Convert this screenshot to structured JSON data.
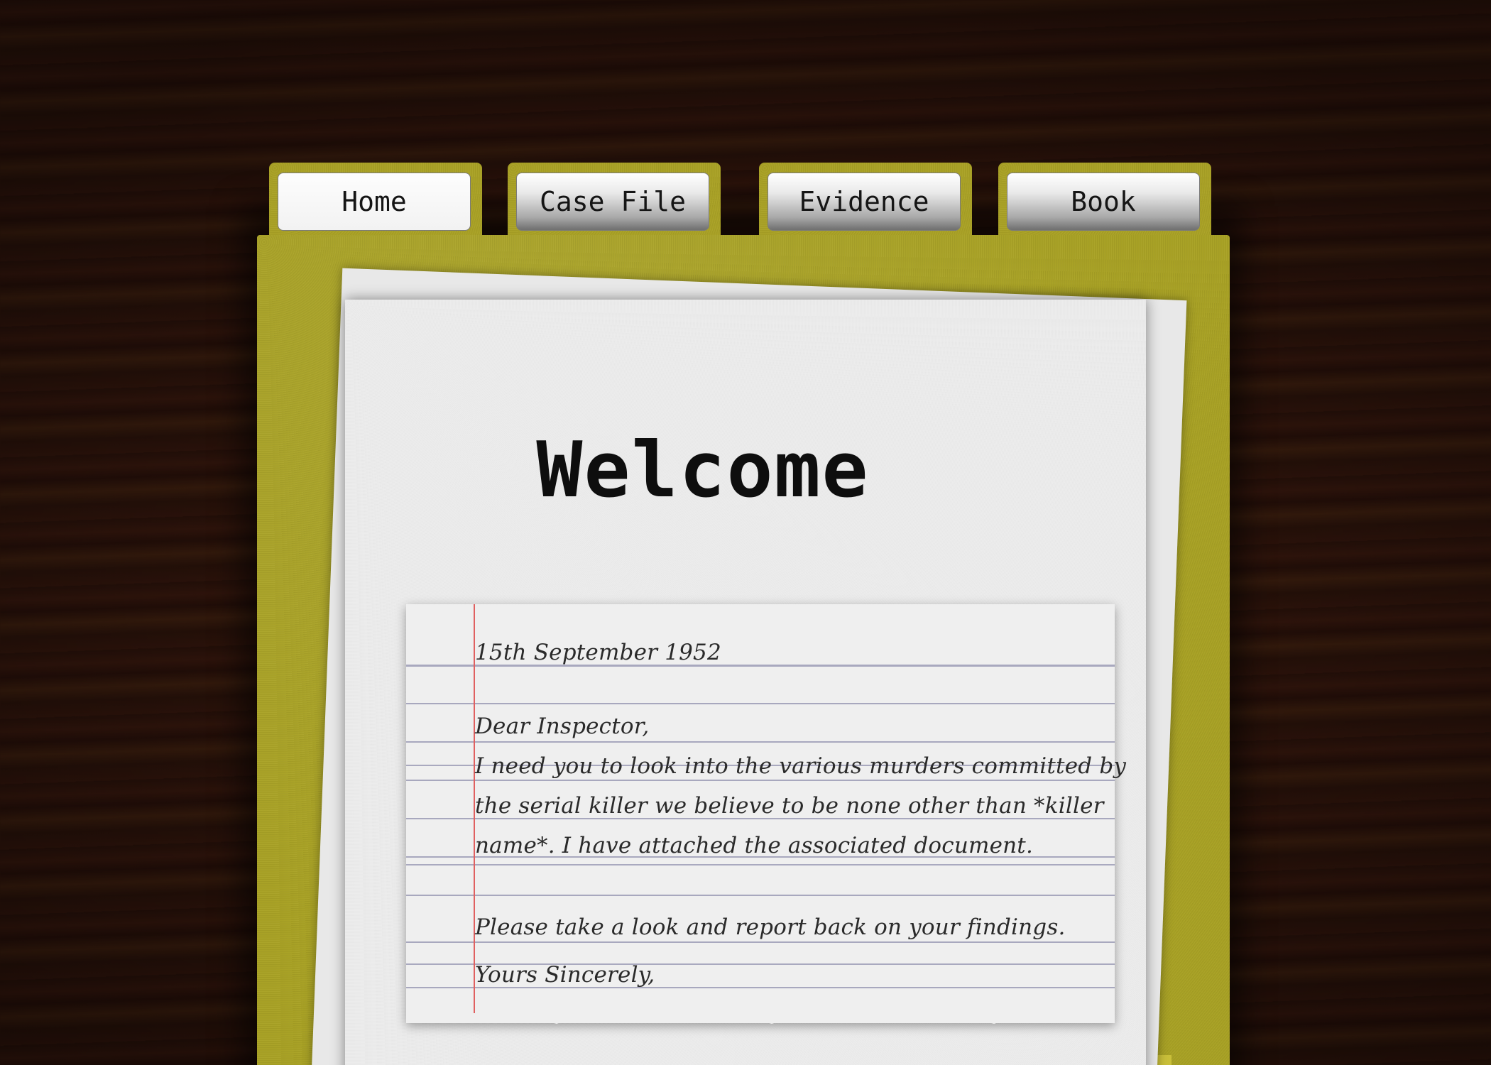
{
  "tabs": [
    {
      "label": "Home",
      "active": true
    },
    {
      "label": "Case File",
      "active": false
    },
    {
      "label": "Evidence",
      "active": false
    },
    {
      "label": "Book",
      "active": false
    }
  ],
  "page": {
    "title": "Welcome"
  },
  "letter": {
    "date": "15th September 1952",
    "salutation": "Dear Inspector,",
    "body_lines": [
      "I need you to look into the various murders committed by",
      "the serial killer we believe to be none other than *killer",
      "name*. I have attached the associated document."
    ],
    "request": "Please take a look and report back on your findings.",
    "closing": "Yours Sincerely,"
  },
  "colors": {
    "folder": "#a9a225",
    "desk": "#2e140b",
    "paper": "#ececec",
    "margin_line": "#e06060",
    "rule_line": "#a8a8be"
  }
}
